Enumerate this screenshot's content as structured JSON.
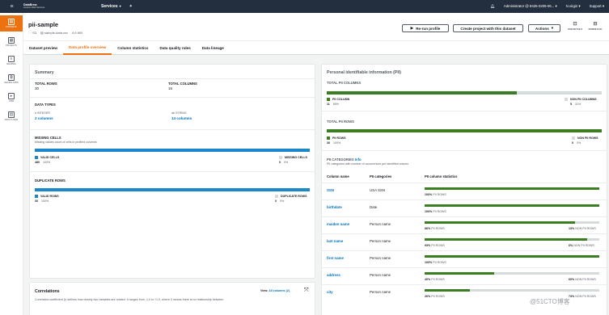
{
  "topbar": {
    "org_line1": "DataBrew",
    "org_line2": "Amazon Web Services",
    "services_label": "Services",
    "account": "Administrator @ 8426-3205-06...",
    "region": "N.virgin",
    "support": "Support"
  },
  "nav": [
    {
      "label": "DATASETS",
      "icon": "datasets-icon",
      "active": true
    },
    {
      "label": "PROJECTS",
      "icon": "projects-icon"
    },
    {
      "label": "RECIPES",
      "icon": "recipes-icon"
    },
    {
      "label": "RECIPE-JOBS",
      "icon": "recipe-jobs-icon"
    },
    {
      "label": "JOBS",
      "icon": "jobs-icon"
    },
    {
      "label": "WHAT'S NEW",
      "icon": "whats-new-icon"
    }
  ],
  "header": {
    "title": "pii-sample",
    "source": "S3",
    "file": "sample-data.csv",
    "size": "4.6 KiB",
    "rerun": "Re-run profile",
    "create_project": "Create project with this dataset",
    "actions": "Actions",
    "job_details": "JOB DETAILS",
    "download": "DOWNLOAD"
  },
  "tabs": [
    "Dataset preview",
    "Data profile overview",
    "Column statistics",
    "Data quality rules",
    "Data lineage"
  ],
  "summary": {
    "title": "Summary",
    "total_rows_label": "TOTAL ROWS",
    "total_rows": "30",
    "total_cols_label": "TOTAL COLUMNS",
    "total_cols": "16",
    "data_types_label": "DATA TYPES",
    "integer_label": "INTEGER",
    "integer_value": "2 columns",
    "string_label": "STRING",
    "string_value": "14 columns",
    "missing_label": "MISSING CELLS",
    "missing_desc": "Missing values count of cells in profiled columns",
    "valid_cells_label": "VALID CELLS",
    "valid_cells_value": "480",
    "valid_cells_pct": "100%",
    "missing_cells_label": "MISSING CELLS",
    "missing_cells_value": "0",
    "missing_cells_pct": "0%",
    "missing_fill": 1.0,
    "dup_label": "DUPLICATE ROWS",
    "valid_rows_label": "VALID ROWS",
    "valid_rows_value": "30",
    "valid_rows_pct": "100%",
    "dup_rows_label": "DUPLICATE ROWS",
    "dup_rows_value": "0",
    "dup_rows_pct": "0%",
    "dup_fill": 1.0
  },
  "correlations": {
    "title": "Correlations",
    "view_label": "View:",
    "view_value": "All columns (2)",
    "desc": "Correlation coefficient (r) defines how closely two variables are related. It ranges from -1.0 to +1.0, where 0 means there is no relationship between"
  },
  "pii": {
    "title": "Personal identifiable information (PII)",
    "total_cols_label": "TOTAL PII COLUMNS",
    "pii_col_label": "PII COLUMN",
    "pii_col_value": "11",
    "pii_col_pct": "69%",
    "non_pii_col_label": "NON PII COLUMNS",
    "non_pii_col_value": "5",
    "non_pii_col_pct": "31%",
    "cols_fill": 0.69,
    "total_rows_label": "TOTAL PII ROWS",
    "pii_rows_label": "PII ROWS",
    "pii_rows_value": "30",
    "pii_rows_pct": "100%",
    "non_pii_rows_label": "NON PII ROWS",
    "non_pii_rows_value": "0",
    "non_pii_rows_pct": "0%",
    "rows_fill": 1.0,
    "categories_label": "PII CATEGORIES",
    "info": "Info",
    "categories_desc": "PII categories with number of occurrences per identified column.",
    "col_headers": [
      "Column name",
      "PII categories",
      "PII column statistics"
    ],
    "rows": [
      {
        "name": "SSN",
        "category": "USA SSN",
        "pii_pct": "100%",
        "pii_label": "PII ROWS",
        "fill": 1.0,
        "non": ""
      },
      {
        "name": "birthdate",
        "category": "Date",
        "pii_pct": "100%",
        "pii_label": "PII ROWS",
        "fill": 1.0,
        "non": ""
      },
      {
        "name": "maiden name",
        "category": "Person name",
        "pii_pct": "86%",
        "pii_label": "PII ROWS",
        "fill": 0.86,
        "non": "13%",
        "non_label": "NON PII ROWS"
      },
      {
        "name": "last name",
        "category": "Person name",
        "pii_pct": "93%",
        "pii_label": "PII ROWS",
        "fill": 0.93,
        "non": "6%",
        "non_label": "NON PII ROWS"
      },
      {
        "name": "first name",
        "category": "Person name",
        "pii_pct": "100%",
        "pii_label": "PII ROWS",
        "fill": 1.0,
        "non": ""
      },
      {
        "name": "address",
        "category": "Person name",
        "pii_pct": "40%",
        "pii_label": "PII ROWS",
        "fill": 0.4,
        "non": "60%",
        "non_label": "NON PII ROWS"
      },
      {
        "name": "city",
        "category": "Person name",
        "pii_pct": "26%",
        "pii_label": "PII ROWS",
        "fill": 0.26,
        "non": "73%",
        "non_label": "NON PII ROWS"
      }
    ]
  },
  "watermark": "@51CTO博客",
  "colors": {
    "green": "#3b7d23",
    "accent": "#ec7211",
    "blue": "#1b86c8"
  }
}
